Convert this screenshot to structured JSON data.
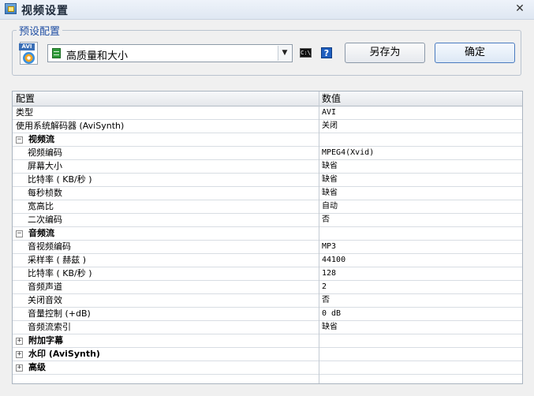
{
  "window": {
    "title": "视频设置",
    "close_glyph": "✕"
  },
  "preset": {
    "legend": "预设配置",
    "avi_icon_label": "AVI",
    "selected": "高质量和大小",
    "cmd_icon_text": "C:\\",
    "help_glyph": "?",
    "save_as_label": "另存为",
    "ok_label": "确定"
  },
  "grid": {
    "columns": [
      "配置",
      "数值"
    ],
    "rows": [
      {
        "type": "prop",
        "key": "类型",
        "value": "AVI",
        "indent": false
      },
      {
        "type": "prop",
        "key": "使用系统解码器 (AviSynth)",
        "value": "关闭",
        "indent": false
      },
      {
        "type": "cat",
        "key": "视频流",
        "expanded": true
      },
      {
        "type": "prop",
        "key": "视频编码",
        "value": "MPEG4(Xvid)",
        "indent": true
      },
      {
        "type": "prop",
        "key": "屏幕大小",
        "value": "缺省",
        "indent": true
      },
      {
        "type": "prop",
        "key": "比特率 ( KB/秒 )",
        "value": "缺省",
        "indent": true
      },
      {
        "type": "prop",
        "key": "每秒桢数",
        "value": "缺省",
        "indent": true
      },
      {
        "type": "prop",
        "key": "宽高比",
        "value": "自动",
        "indent": true
      },
      {
        "type": "prop",
        "key": "二次编码",
        "value": "否",
        "indent": true
      },
      {
        "type": "cat",
        "key": "音频流",
        "expanded": true
      },
      {
        "type": "prop",
        "key": "音视频编码",
        "value": "MP3",
        "indent": true
      },
      {
        "type": "prop",
        "key": "采样率 ( 赫兹 )",
        "value": "44100",
        "indent": true
      },
      {
        "type": "prop",
        "key": "比特率 ( KB/秒 )",
        "value": "128",
        "indent": true
      },
      {
        "type": "prop",
        "key": "音频声道",
        "value": "2",
        "indent": true
      },
      {
        "type": "prop",
        "key": "关闭音效",
        "value": "否",
        "indent": true
      },
      {
        "type": "prop",
        "key": "音量控制 (+dB)",
        "value": "0 dB",
        "indent": true
      },
      {
        "type": "prop",
        "key": "音频流索引",
        "value": "缺省",
        "indent": true
      },
      {
        "type": "cat",
        "key": "附加字幕",
        "expanded": false
      },
      {
        "type": "cat",
        "key": "水印 (AviSynth)",
        "expanded": false
      },
      {
        "type": "cat",
        "key": "高级",
        "expanded": false
      }
    ]
  }
}
